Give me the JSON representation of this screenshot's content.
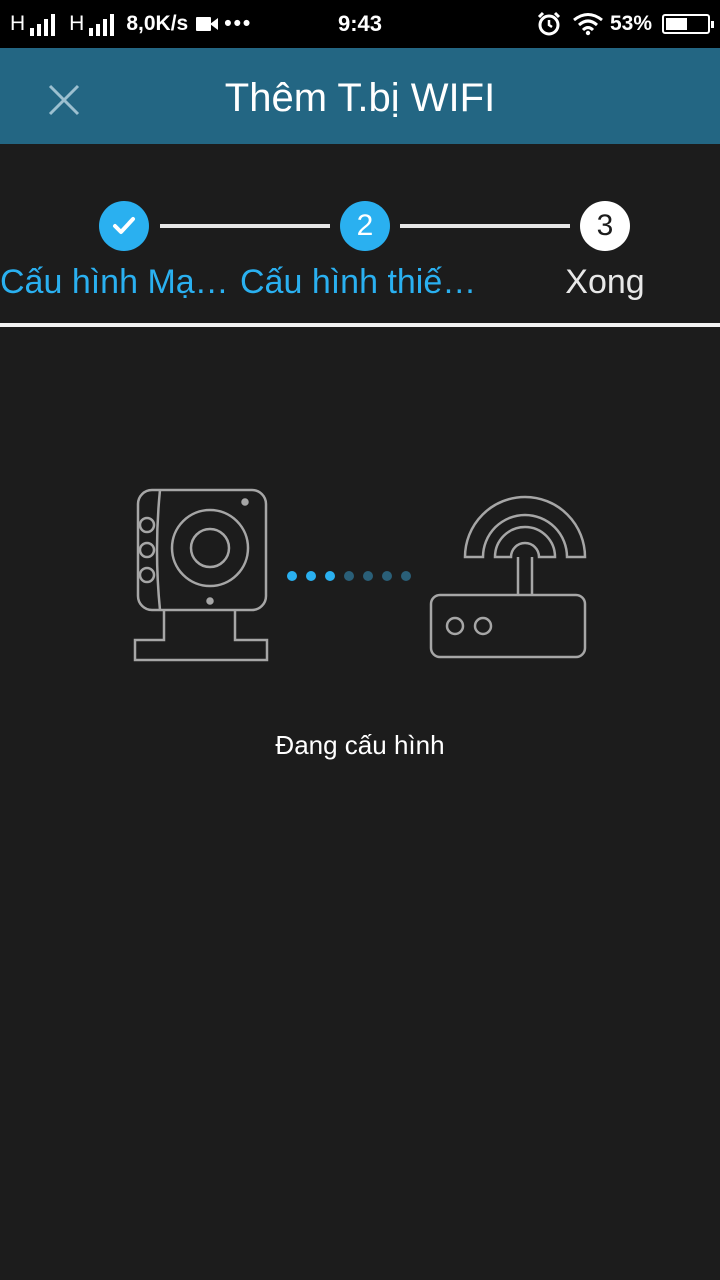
{
  "status_bar": {
    "net1": "H",
    "net2": "H",
    "speed": "8,0K/s",
    "more": "•••",
    "time": "9:43",
    "battery": "53%",
    "battery_level": 0.53
  },
  "header": {
    "title": "Thêm T.bị WIFI"
  },
  "stepper": {
    "steps": [
      {
        "number": "",
        "label": "Cấu hình Mạ…",
        "state": "done"
      },
      {
        "number": "2",
        "label": "Cấu hình thiế…",
        "state": "active"
      },
      {
        "number": "3",
        "label": "Xong",
        "state": "pending"
      }
    ]
  },
  "main": {
    "status": "Đang cấu hình",
    "progress_dots_total": 7,
    "progress_dots_active": 3
  },
  "colors": {
    "accent": "#2ab0f0",
    "header_bg": "#236683",
    "background": "#1c1c1c",
    "outline": "#a6a6a6"
  }
}
